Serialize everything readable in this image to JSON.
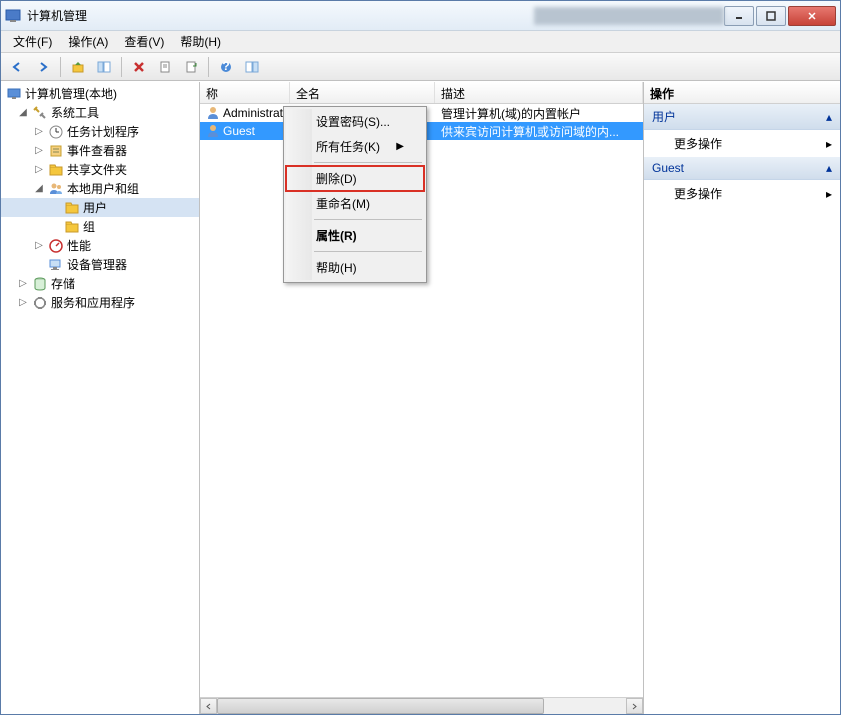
{
  "window": {
    "title": "计算机管理"
  },
  "menubar": {
    "file": "文件(F)",
    "action": "操作(A)",
    "view": "查看(V)",
    "help": "帮助(H)"
  },
  "tree": {
    "root": "计算机管理(本地)",
    "system_tools": "系统工具",
    "task_scheduler": "任务计划程序",
    "event_viewer": "事件查看器",
    "shared_folders": "共享文件夹",
    "local_users_groups": "本地用户和组",
    "users": "用户",
    "groups": "组",
    "performance": "性能",
    "device_manager": "设备管理器",
    "storage": "存储",
    "services_apps": "服务和应用程序"
  },
  "list": {
    "headers": {
      "name": "称",
      "fullname": "全名",
      "description": "描述"
    },
    "rows": [
      {
        "name": "Administrat...",
        "fullname": "",
        "description": "管理计算机(域)的内置帐户"
      },
      {
        "name": "Guest",
        "fullname": "",
        "description": "供来宾访问计算机或访问域的内..."
      }
    ]
  },
  "actions": {
    "header": "操作",
    "group1": "用户",
    "group1_item": "更多操作",
    "group2": "Guest",
    "group2_item": "更多操作"
  },
  "context_menu": {
    "set_password": "设置密码(S)...",
    "all_tasks": "所有任务(K)",
    "delete": "删除(D)",
    "rename": "重命名(M)",
    "properties": "属性(R)",
    "help": "帮助(H)"
  }
}
